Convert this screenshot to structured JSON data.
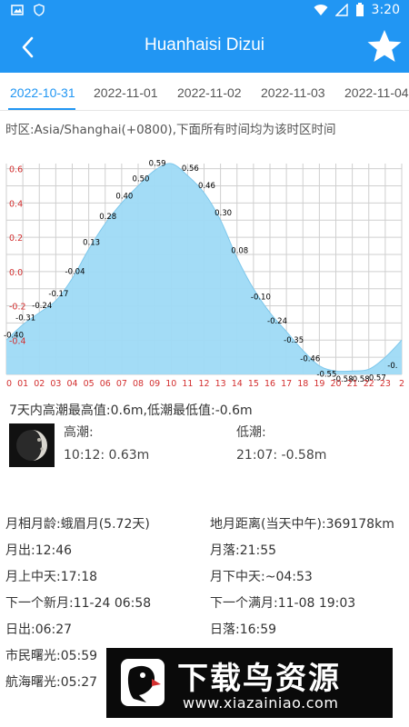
{
  "status_bar": {
    "time": "3:20"
  },
  "app_bar": {
    "title": "Huanhaisi Dizui"
  },
  "tabs": [
    {
      "label": "2022-10-31",
      "active": true
    },
    {
      "label": "2022-11-01",
      "active": false
    },
    {
      "label": "2022-11-02",
      "active": false
    },
    {
      "label": "2022-11-03",
      "active": false
    },
    {
      "label": "2022-11-04",
      "active": false
    }
  ],
  "timezone_note": "时区:Asia/Shanghai(+0800),下面所有时间均为该时区时间",
  "chart_data": {
    "type": "area",
    "x": [
      0,
      1,
      2,
      3,
      4,
      5,
      6,
      7,
      8,
      9,
      10,
      11,
      12,
      13,
      14,
      15,
      16,
      17,
      18,
      19,
      20,
      21,
      22,
      23,
      24
    ],
    "xticks": [
      "0",
      "01",
      "02",
      "03",
      "04",
      "05",
      "06",
      "07",
      "08",
      "09",
      "10",
      "11",
      "12",
      "13",
      "14",
      "15",
      "16",
      "17",
      "18",
      "19",
      "20",
      "21",
      "22",
      "23",
      "2"
    ],
    "yticks": [
      "0.6",
      "0.4",
      "0.2",
      "0.0",
      "-0.2",
      "-0.4"
    ],
    "ylim": [
      -0.6,
      0.63
    ],
    "series": [
      {
        "values": [
          -0.4,
          -0.31,
          -0.24,
          -0.17,
          -0.04,
          0.13,
          0.28,
          0.4,
          0.5,
          0.59,
          0.63,
          0.56,
          0.46,
          0.3,
          0.08,
          -0.1,
          -0.24,
          -0.35,
          -0.46,
          -0.55,
          -0.58,
          -0.58,
          -0.57,
          -0.5,
          -0.4
        ]
      }
    ],
    "data_labels": [
      "-0.40",
      "-0.31",
      "-0.24",
      "-0.17",
      "-0.04",
      "0.13",
      "0.28",
      "0.40",
      "0.50",
      "0.59",
      "",
      "0.56",
      "0.46",
      "0.30",
      "0.08",
      "-0.10",
      "-0.24",
      "-0.35",
      "-0.46",
      "-0.55",
      "-0.58",
      "-0.58",
      "-0.57",
      "-0.",
      ""
    ],
    "colors": {
      "fill": "#9edaf5",
      "grid": "#cfcfcf",
      "axis_text": "#d32f2f",
      "label": "#000000"
    },
    "grid": true
  },
  "summary": "7天内高潮最高值:0.6m,低潮最低值:-0.6m",
  "tide": {
    "high_label": "高潮:",
    "high_value": "10:12: 0.63m",
    "low_label": "低潮:",
    "low_value": "21:07: -0.58m"
  },
  "info_left": [
    "月相月龄:蛾眉月(5.72天)",
    "月出:12:46",
    "月上中天:17:18",
    "下一个新月:11-24 06:58",
    "日出:06:27",
    "市民曙光:05:59",
    "航海曙光:05:27"
  ],
  "info_right": [
    "地月距离(当天中午):369178km",
    "月落:21:55",
    "月下中天:~04:53",
    "下一个满月:11-08 19:03",
    "日落:16:59"
  ],
  "banner": {
    "title": "下载鸟资源",
    "url": "www.xiazainiao.com"
  }
}
